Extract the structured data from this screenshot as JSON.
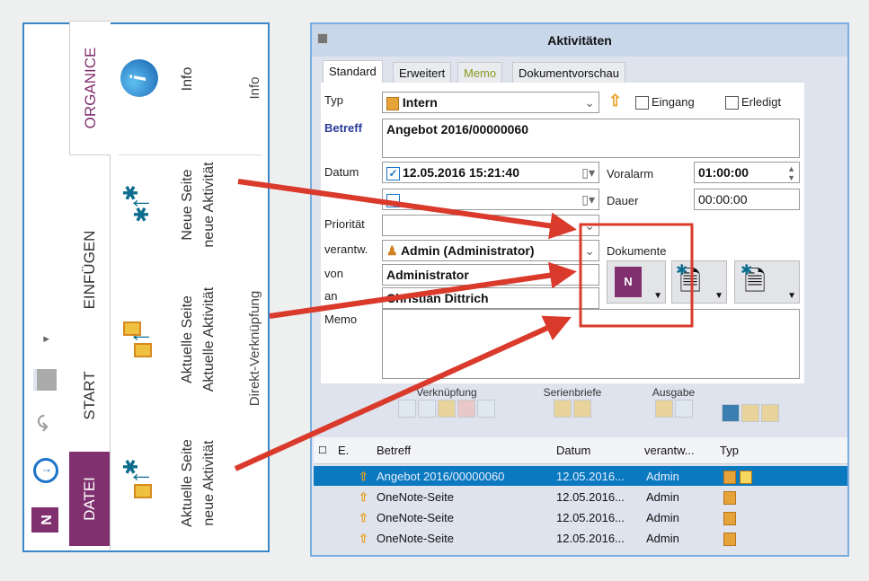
{
  "ribbon": {
    "tabs": [
      "DATEI",
      "START",
      "EINFÜGEN",
      "ORGANICE"
    ],
    "groups": [
      {
        "label": "Direkt-Verknüpfung",
        "buttons": [
          {
            "line1": "Aktuelle Seite",
            "line2": "neue Aktivität"
          },
          {
            "line1": "Aktuelle Seite",
            "line2": "Aktuelle Aktivität"
          },
          {
            "line1": "Neue Seite",
            "line2": "neue Aktivität"
          }
        ]
      },
      {
        "label": "Info",
        "buttons": [
          {
            "line1": "Info"
          }
        ]
      }
    ]
  },
  "dialog": {
    "title": "Aktivitäten",
    "tabs": [
      "Standard",
      "Erweitert",
      "Memo",
      "Dokumentvorschau"
    ],
    "labels": {
      "typ": "Typ",
      "betreff": "Betreff",
      "datum": "Datum",
      "prioritaet": "Priorität",
      "verantw": "verantw.",
      "von": "von",
      "an": "an",
      "memo": "Memo",
      "voralarm": "Voralarm",
      "dauer": "Dauer",
      "dokumente": "Dokumente",
      "eingang": "Eingang",
      "erledigt": "Erledigt"
    },
    "values": {
      "typ": "Intern",
      "betreff": "Angebot 2016/00000060",
      "datum": "12.05.2016 15:21:40",
      "voralarm": "01:00:00",
      "dauer": "00:00:00",
      "verantw": "Admin (Administrator)",
      "von": "Administrator",
      "an": "Christian Dittrich",
      "memo": ""
    },
    "toolbar_groups": [
      "Verknüpfung",
      "Serienbriefe",
      "Ausgabe"
    ],
    "table": {
      "headers": [
        "E.",
        "Betreff",
        "Datum",
        "verantw...",
        "Typ"
      ],
      "rows": [
        {
          "betreff": "Angebot 2016/00000060",
          "datum": "12.05.2016...",
          "verantw": "Admin",
          "selected": true
        },
        {
          "betreff": "OneNote-Seite",
          "datum": "12.05.2016...",
          "verantw": "Admin"
        },
        {
          "betreff": "OneNote-Seite",
          "datum": "12.05.2016...",
          "verantw": "Admin"
        },
        {
          "betreff": "OneNote-Seite",
          "datum": "12.05.2016...",
          "verantw": "Admin"
        }
      ]
    }
  },
  "colors": {
    "accent_purple": "#80306f",
    "arrow_red": "#d93a2b",
    "selection": "#0b79c0"
  }
}
